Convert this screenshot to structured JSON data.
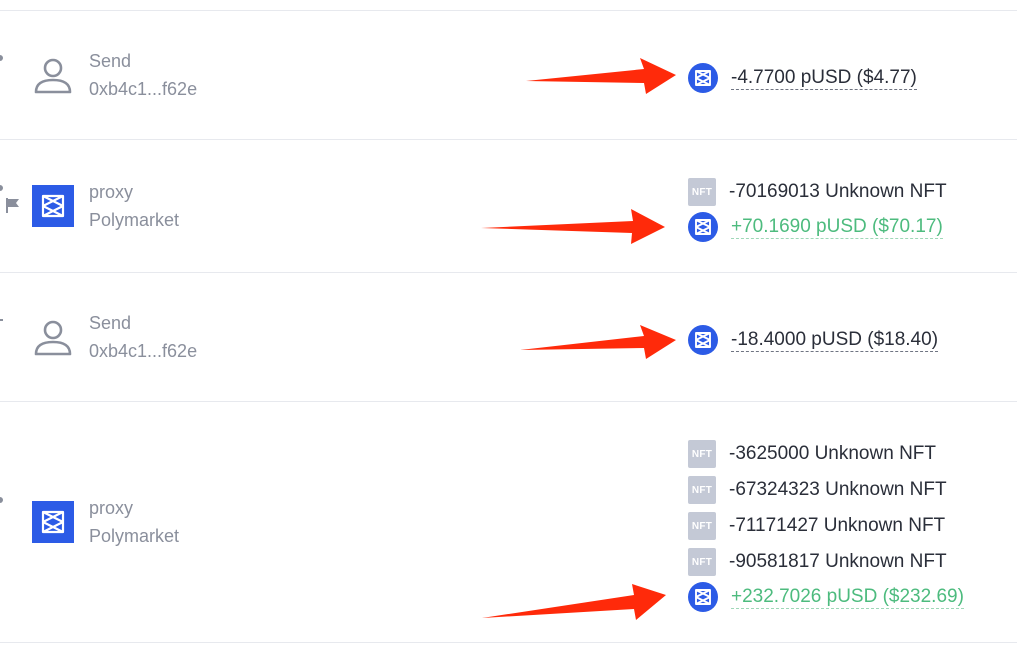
{
  "colors": {
    "brand": "#2c5be6",
    "positive": "#4dbb7e",
    "muted": "#8a8f9c",
    "arrow": "#ff2a0a",
    "nft_badge": "#c4c9d6"
  },
  "transactions": [
    {
      "type_label": "Send",
      "counterparty": "0xb4c1...f62e",
      "avatar_icon": "user-icon",
      "transfers": [
        {
          "kind": "token",
          "icon": "polymarket-icon",
          "amount": "-4.7700 pUSD ($4.77)",
          "direction": "out"
        }
      ]
    },
    {
      "type_label": "proxy",
      "counterparty": "Polymarket",
      "avatar_icon": "polymarket-logo",
      "transfers": [
        {
          "kind": "nft",
          "icon_text": "NFT",
          "amount": "-70169013 Unknown NFT"
        },
        {
          "kind": "token",
          "icon": "polymarket-icon",
          "amount": "+70.1690 pUSD ($70.17)",
          "direction": "in"
        }
      ]
    },
    {
      "type_label": "Send",
      "counterparty": "0xb4c1...f62e",
      "avatar_icon": "user-icon",
      "transfers": [
        {
          "kind": "token",
          "icon": "polymarket-icon",
          "amount": "-18.4000 pUSD ($18.40)",
          "direction": "out"
        }
      ]
    },
    {
      "type_label": "proxy",
      "counterparty": "Polymarket",
      "avatar_icon": "polymarket-logo",
      "transfers": [
        {
          "kind": "nft",
          "icon_text": "NFT",
          "amount": "-3625000 Unknown NFT"
        },
        {
          "kind": "nft",
          "icon_text": "NFT",
          "amount": "-67324323 Unknown NFT"
        },
        {
          "kind": "nft",
          "icon_text": "NFT",
          "amount": "-71171427 Unknown NFT"
        },
        {
          "kind": "nft",
          "icon_text": "NFT",
          "amount": "-90581817 Unknown NFT"
        },
        {
          "kind": "token",
          "icon": "polymarket-icon",
          "amount": "+232.7026 pUSD ($232.69)",
          "direction": "in"
        }
      ]
    }
  ]
}
